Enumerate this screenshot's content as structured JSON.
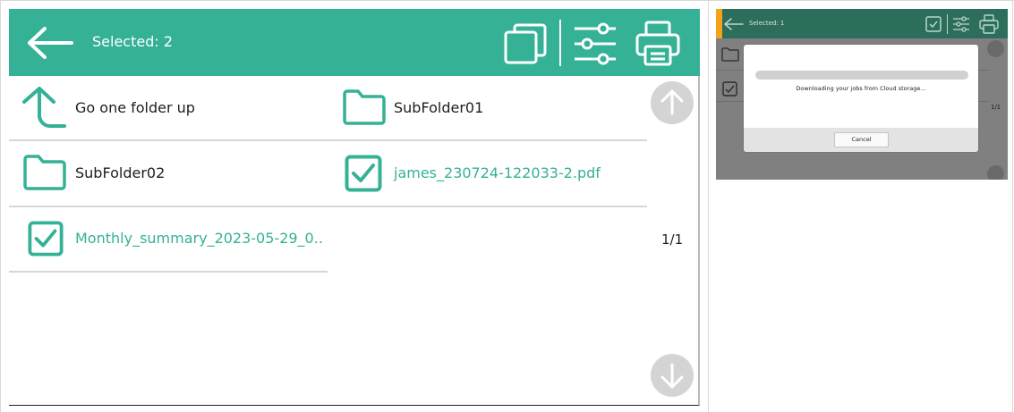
{
  "header": {
    "selected_text": "Selected: 2",
    "accent_color": "#35b196",
    "icons": [
      "back-arrow-icon",
      "select-all-icon",
      "settings-sliders-icon",
      "print-icon"
    ]
  },
  "items": {
    "go_up": {
      "label": "Go one folder up",
      "icon": "folder-up-arrow-icon"
    },
    "subfolder01": {
      "label": "SubFolder01",
      "icon": "folder-icon"
    },
    "subfolder02": {
      "label": "SubFolder02",
      "icon": "folder-icon"
    },
    "file1": {
      "label": "james_230724-122033-2.pdf",
      "icon": "checkbox-checked-icon",
      "selected": true
    },
    "file2": {
      "label": "Monthly_summary_2023-05-29_0..",
      "icon": "checkbox-checked-icon",
      "selected": true
    }
  },
  "pagination": {
    "indicator": "1/1"
  },
  "mini_panel": {
    "selected_text": "Selected: 1",
    "page_indicator": "1/1",
    "dialog": {
      "message": "Downloading your jobs from Cloud storage...",
      "cancel_label": "Cancel"
    }
  }
}
